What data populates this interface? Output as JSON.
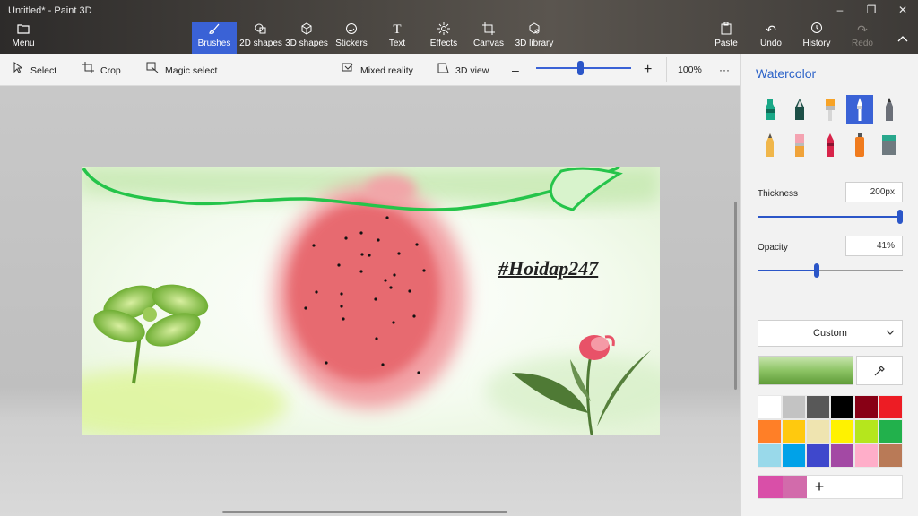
{
  "window": {
    "title": "Untitled* - Paint 3D",
    "controls": {
      "minimize": "–",
      "maximize": "❐",
      "close": "✕"
    }
  },
  "ribbon": {
    "menu": "Menu",
    "tools": [
      {
        "label": "Brushes",
        "icon": "brush-icon",
        "active": true
      },
      {
        "label": "2D shapes",
        "icon": "2d-shapes-icon"
      },
      {
        "label": "3D shapes",
        "icon": "3d-shapes-icon"
      },
      {
        "label": "Stickers",
        "icon": "stickers-icon"
      },
      {
        "label": "Text",
        "icon": "text-icon"
      },
      {
        "label": "Effects",
        "icon": "effects-icon"
      },
      {
        "label": "Canvas",
        "icon": "canvas-icon"
      },
      {
        "label": "3D library",
        "icon": "3d-library-icon"
      }
    ],
    "paste": "Paste",
    "undo": "Undo",
    "history": "History",
    "redo": "Redo",
    "accent_color": "#3a62d6"
  },
  "toolbar": {
    "select": "Select",
    "crop": "Crop",
    "magic_select": "Magic select",
    "mixed_reality": "Mixed reality",
    "view_3d": "3D view",
    "zoom_out": "–",
    "zoom_in": "+",
    "zoom_level": "100%",
    "zoom_fraction": 0.46,
    "more": "···"
  },
  "canvas": {
    "hashtag": "#Hoidap247"
  },
  "panel": {
    "title": "Watercolor",
    "brushes": [
      "marker-icon",
      "calligraphy-pen-icon",
      "oil-brush-icon",
      "watercolor-icon",
      "pixel-pen-icon",
      "pencil-icon",
      "eraser-icon",
      "crayon-icon",
      "spray-can-icon",
      "fill-bucket-icon"
    ],
    "active_brush": "watercolor-icon",
    "thickness_label": "Thickness",
    "thickness_value": "200px",
    "thickness_fraction": 1.0,
    "opacity_label": "Opacity",
    "opacity_value": "41%",
    "opacity_fraction": 0.41,
    "color_mode": "Custom",
    "current_color": "#8dc465",
    "palette": [
      "#ffffff",
      "#c3c3c3",
      "#585858",
      "#000000",
      "#880015",
      "#ed1c24",
      "#ff7f27",
      "#ffc90e",
      "#efe4b0",
      "#fff200",
      "#b5e61d",
      "#22b14c",
      "#99d9ea",
      "#00a2e8",
      "#3f48cc",
      "#a349a4",
      "#ffaec9",
      "#b97a57"
    ],
    "custom_colors": [
      "#d94fa8",
      "#d26bab"
    ],
    "add_color": "+"
  }
}
